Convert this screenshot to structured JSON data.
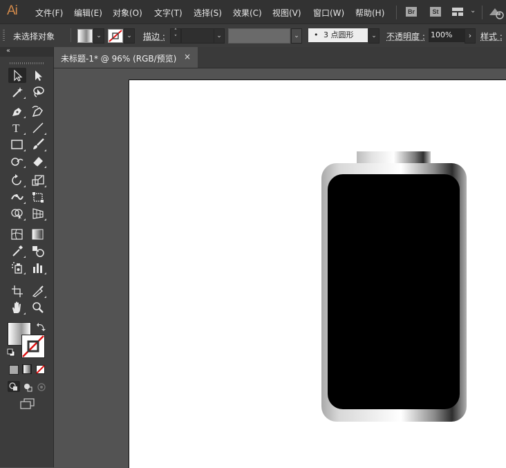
{
  "app": {
    "logo": "Ai"
  },
  "menu": [
    "文件(F)",
    "编辑(E)",
    "对象(O)",
    "文字(T)",
    "选择(S)",
    "效果(C)",
    "视图(V)",
    "窗口(W)",
    "帮助(H)"
  ],
  "app_badges": [
    "Br",
    "St"
  ],
  "control_bar": {
    "selection_status": "未选择对象",
    "stroke_label": "描边 :",
    "brush_value": "3 点圆形",
    "brush_bullet": "•",
    "opacity_label": "不透明度 :",
    "opacity_value": "100%",
    "style_label": "样式 :"
  },
  "document_tab": {
    "title": "未标题-1* @ 96% (RGB/预览)",
    "close": "×"
  },
  "tools": [
    "selection-tool",
    "direct-selection-tool",
    "magic-wand-tool",
    "lasso-tool",
    "pen-tool",
    "curvature-tool",
    "type-tool",
    "line-segment-tool",
    "rectangle-tool",
    "paintbrush-tool",
    "shaper-tool",
    "eraser-tool",
    "rotate-tool",
    "scale-tool",
    "width-tool",
    "free-transform-tool",
    "shape-builder-tool",
    "perspective-grid-tool",
    "mesh-tool",
    "gradient-tool",
    "eyedropper-tool",
    "blend-tool",
    "symbol-sprayer-tool",
    "column-graph-tool",
    "artboard-tool",
    "slice-tool",
    "hand-tool",
    "zoom-tool"
  ],
  "colors": {
    "accent": "#d28a4b",
    "interface": "#535353",
    "artboard": "#ffffff",
    "battery_body": "#000000"
  }
}
